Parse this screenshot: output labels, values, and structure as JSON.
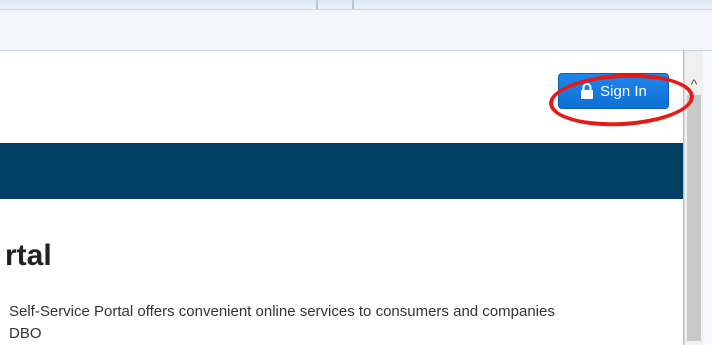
{
  "header": {
    "signin_label": "Sign In",
    "signin_icon": "lock-icon"
  },
  "main": {
    "title_fragment": "rtal",
    "intro_line1": "Self-Service Portal offers convenient online services to consumers and companies",
    "intro_line2": "DBO"
  },
  "colors": {
    "nav_band": "#003e63",
    "signin_button": "#1f86ec",
    "annotation": "#e81a16"
  }
}
